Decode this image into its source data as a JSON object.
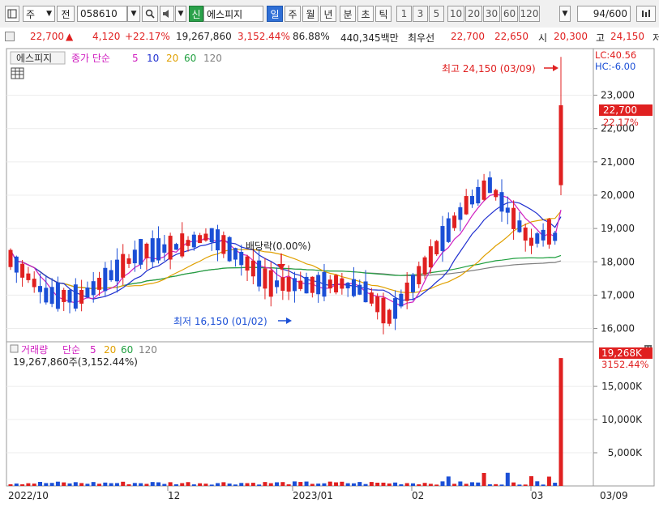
{
  "toolbar": {
    "market": "주",
    "type": "전",
    "code": "058610",
    "badge_new": "신",
    "name": "에스피지",
    "periods": [
      "일",
      "주",
      "월",
      "년"
    ],
    "subperiods": [
      "분",
      "초",
      "틱"
    ],
    "minutes": [
      "1",
      "3",
      "5",
      "10",
      "20",
      "30",
      "60",
      "120"
    ],
    "count": "94",
    "count_total": "/600"
  },
  "quote": {
    "price": "22,700",
    "arrow": "▲",
    "change": "4,120",
    "rate": "+22.17%",
    "volume": "19,267,860",
    "vol_rate": "3,152.44%",
    "turnover": "86.88%",
    "amount": "440,345백만",
    "label_best": "최우선",
    "ask": "22,700",
    "bid": "22,650",
    "label_open": "시",
    "open": "20,300",
    "label_high": "고",
    "high": "24,150",
    "label_cut": "저"
  },
  "price_panel": {
    "tab": "에스피지",
    "indicator": "종가 단순",
    "ma": [
      "5",
      "10",
      "20",
      "60",
      "120"
    ],
    "lc": "LC:40.56",
    "hc": "HC:-6.00",
    "high_note": "최고 24,150 (03/09)",
    "low_note": "최저 16,150 (01/02)",
    "dividend_note": "배당락(0.00%)",
    "last_price": "22,700",
    "last_pct": "22.17%"
  },
  "volume_panel": {
    "title": "거래량",
    "indicator": "단순",
    "ma": [
      "5",
      "20",
      "60",
      "120"
    ],
    "detail": "19,267,860주(3,152.44%)",
    "last_vol": "19,268K",
    "last_pct": "3152.44%"
  },
  "x_axis": [
    "2022/10",
    "12",
    "2023/01",
    "02",
    "03",
    "03/09"
  ],
  "colors": {
    "up": "#e02020",
    "down": "#1b4fd6",
    "ma5": "#d020c0",
    "ma10": "#2030d0",
    "ma20": "#e0a000",
    "ma60": "#20a040",
    "ma120": "#808080"
  },
  "chart_data": {
    "type": "candlestick",
    "y_ticks": [
      16000,
      17000,
      18000,
      19000,
      20000,
      21000,
      22000,
      23000
    ],
    "ylim": [
      15600,
      24400
    ],
    "volume_ticks_k": [
      5000,
      10000,
      15000
    ],
    "high": 24150,
    "low": 16150,
    "last": 22700,
    "last_volume_k": 19268
  }
}
